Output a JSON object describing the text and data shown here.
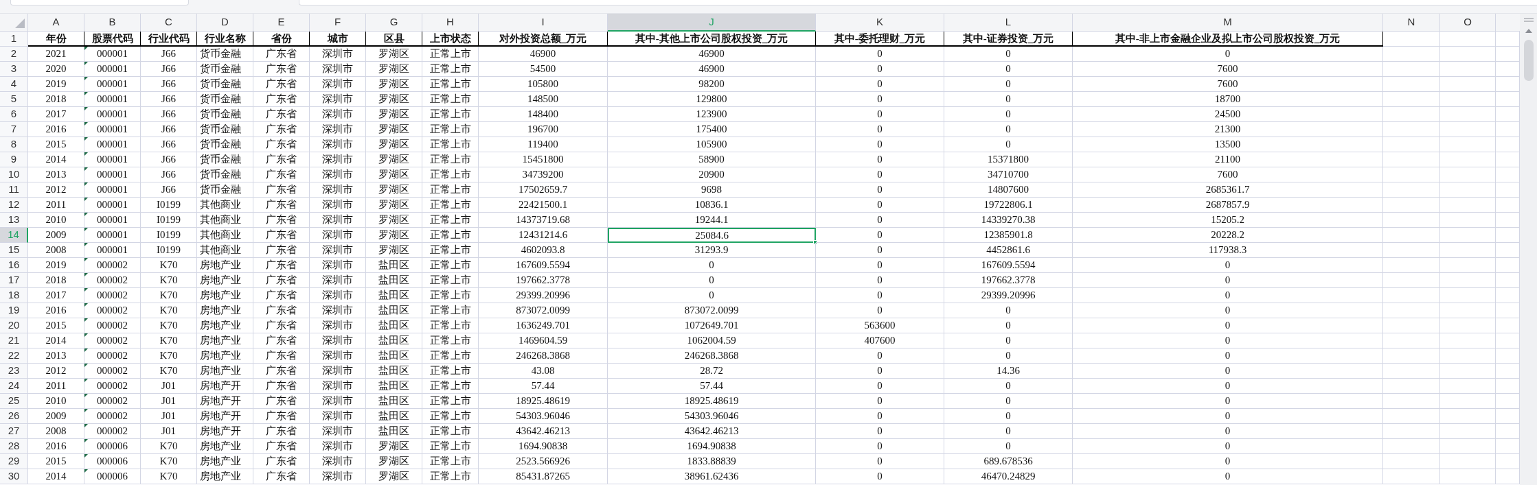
{
  "columns": [
    {
      "letter": "A",
      "selected": false
    },
    {
      "letter": "B",
      "selected": false
    },
    {
      "letter": "C",
      "selected": false
    },
    {
      "letter": "D",
      "selected": false
    },
    {
      "letter": "E",
      "selected": false
    },
    {
      "letter": "F",
      "selected": false
    },
    {
      "letter": "G",
      "selected": false
    },
    {
      "letter": "H",
      "selected": false
    },
    {
      "letter": "I",
      "selected": false
    },
    {
      "letter": "J",
      "selected": true
    },
    {
      "letter": "K",
      "selected": false
    },
    {
      "letter": "L",
      "selected": false
    },
    {
      "letter": "M",
      "selected": false
    },
    {
      "letter": "N",
      "selected": false
    },
    {
      "letter": "O",
      "selected": false
    }
  ],
  "header_row": {
    "number": "1",
    "selected": false,
    "cells": [
      "年份",
      "股票代码",
      "行业代码",
      "行业名称",
      "省份",
      "城市",
      "区县",
      "上市状态",
      "对外投资总额_万元",
      "其中-其他上市公司股权投资_万元",
      "其中-委托理财_万元",
      "其中-证券投资_万元",
      "其中-非上市金融企业及拟上市公司股权投资_万元"
    ]
  },
  "rows": [
    {
      "number": "2",
      "selected": false,
      "flagged": true,
      "cells": [
        "2021",
        "000001",
        "J66",
        "货币金融",
        "广东省",
        "深圳市",
        "罗湖区",
        "正常上市",
        "46900",
        "46900",
        "0",
        "0",
        "0"
      ]
    },
    {
      "number": "3",
      "selected": false,
      "flagged": true,
      "cells": [
        "2020",
        "000001",
        "J66",
        "货币金融",
        "广东省",
        "深圳市",
        "罗湖区",
        "正常上市",
        "54500",
        "46900",
        "0",
        "0",
        "7600"
      ]
    },
    {
      "number": "4",
      "selected": false,
      "flagged": true,
      "cells": [
        "2019",
        "000001",
        "J66",
        "货币金融",
        "广东省",
        "深圳市",
        "罗湖区",
        "正常上市",
        "105800",
        "98200",
        "0",
        "0",
        "7600"
      ]
    },
    {
      "number": "5",
      "selected": false,
      "flagged": true,
      "cells": [
        "2018",
        "000001",
        "J66",
        "货币金融",
        "广东省",
        "深圳市",
        "罗湖区",
        "正常上市",
        "148500",
        "129800",
        "0",
        "0",
        "18700"
      ]
    },
    {
      "number": "6",
      "selected": false,
      "flagged": true,
      "cells": [
        "2017",
        "000001",
        "J66",
        "货币金融",
        "广东省",
        "深圳市",
        "罗湖区",
        "正常上市",
        "148400",
        "123900",
        "0",
        "0",
        "24500"
      ]
    },
    {
      "number": "7",
      "selected": false,
      "flagged": true,
      "cells": [
        "2016",
        "000001",
        "J66",
        "货币金融",
        "广东省",
        "深圳市",
        "罗湖区",
        "正常上市",
        "196700",
        "175400",
        "0",
        "0",
        "21300"
      ]
    },
    {
      "number": "8",
      "selected": false,
      "flagged": true,
      "cells": [
        "2015",
        "000001",
        "J66",
        "货币金融",
        "广东省",
        "深圳市",
        "罗湖区",
        "正常上市",
        "119400",
        "105900",
        "0",
        "0",
        "13500"
      ]
    },
    {
      "number": "9",
      "selected": false,
      "flagged": true,
      "cells": [
        "2014",
        "000001",
        "J66",
        "货币金融",
        "广东省",
        "深圳市",
        "罗湖区",
        "正常上市",
        "15451800",
        "58900",
        "0",
        "15371800",
        "21100"
      ]
    },
    {
      "number": "10",
      "selected": false,
      "flagged": true,
      "cells": [
        "2013",
        "000001",
        "J66",
        "货币金融",
        "广东省",
        "深圳市",
        "罗湖区",
        "正常上市",
        "34739200",
        "20900",
        "0",
        "34710700",
        "7600"
      ]
    },
    {
      "number": "11",
      "selected": false,
      "flagged": true,
      "cells": [
        "2012",
        "000001",
        "J66",
        "货币金融",
        "广东省",
        "深圳市",
        "罗湖区",
        "正常上市",
        "17502659.7",
        "9698",
        "0",
        "14807600",
        "2685361.7"
      ]
    },
    {
      "number": "12",
      "selected": false,
      "flagged": true,
      "cells": [
        "2011",
        "000001",
        "I0199",
        "其他商业",
        "广东省",
        "深圳市",
        "罗湖区",
        "正常上市",
        "22421500.1",
        "10836.1",
        "0",
        "19722806.1",
        "2687857.9"
      ]
    },
    {
      "number": "13",
      "selected": false,
      "flagged": true,
      "cells": [
        "2010",
        "000001",
        "I0199",
        "其他商业",
        "广东省",
        "深圳市",
        "罗湖区",
        "正常上市",
        "14373719.68",
        "19244.1",
        "0",
        "14339270.38",
        "15205.2"
      ]
    },
    {
      "number": "14",
      "selected": true,
      "flagged": true,
      "cells": [
        "2009",
        "000001",
        "I0199",
        "其他商业",
        "广东省",
        "深圳市",
        "罗湖区",
        "正常上市",
        "12431214.6",
        "25084.6",
        "0",
        "12385901.8",
        "20228.2"
      ]
    },
    {
      "number": "15",
      "selected": false,
      "flagged": true,
      "cells": [
        "2008",
        "000001",
        "I0199",
        "其他商业",
        "广东省",
        "深圳市",
        "罗湖区",
        "正常上市",
        "4602093.8",
        "31293.9",
        "0",
        "4452861.6",
        "117938.3"
      ]
    },
    {
      "number": "16",
      "selected": false,
      "flagged": true,
      "cells": [
        "2019",
        "000002",
        "K70",
        "房地产业",
        "广东省",
        "深圳市",
        "盐田区",
        "正常上市",
        "167609.5594",
        "0",
        "0",
        "167609.5594",
        "0"
      ]
    },
    {
      "number": "17",
      "selected": false,
      "flagged": true,
      "cells": [
        "2018",
        "000002",
        "K70",
        "房地产业",
        "广东省",
        "深圳市",
        "盐田区",
        "正常上市",
        "197662.3778",
        "0",
        "0",
        "197662.3778",
        "0"
      ]
    },
    {
      "number": "18",
      "selected": false,
      "flagged": true,
      "cells": [
        "2017",
        "000002",
        "K70",
        "房地产业",
        "广东省",
        "深圳市",
        "盐田区",
        "正常上市",
        "29399.20996",
        "0",
        "0",
        "29399.20996",
        "0"
      ]
    },
    {
      "number": "19",
      "selected": false,
      "flagged": true,
      "cells": [
        "2016",
        "000002",
        "K70",
        "房地产业",
        "广东省",
        "深圳市",
        "盐田区",
        "正常上市",
        "873072.0099",
        "873072.0099",
        "0",
        "0",
        "0"
      ]
    },
    {
      "number": "20",
      "selected": false,
      "flagged": true,
      "cells": [
        "2015",
        "000002",
        "K70",
        "房地产业",
        "广东省",
        "深圳市",
        "盐田区",
        "正常上市",
        "1636249.701",
        "1072649.701",
        "563600",
        "0",
        "0"
      ]
    },
    {
      "number": "21",
      "selected": false,
      "flagged": true,
      "cells": [
        "2014",
        "000002",
        "K70",
        "房地产业",
        "广东省",
        "深圳市",
        "盐田区",
        "正常上市",
        "1469604.59",
        "1062004.59",
        "407600",
        "0",
        "0"
      ]
    },
    {
      "number": "22",
      "selected": false,
      "flagged": true,
      "cells": [
        "2013",
        "000002",
        "K70",
        "房地产业",
        "广东省",
        "深圳市",
        "盐田区",
        "正常上市",
        "246268.3868",
        "246268.3868",
        "0",
        "0",
        "0"
      ]
    },
    {
      "number": "23",
      "selected": false,
      "flagged": true,
      "cells": [
        "2012",
        "000002",
        "K70",
        "房地产业",
        "广东省",
        "深圳市",
        "盐田区",
        "正常上市",
        "43.08",
        "28.72",
        "0",
        "14.36",
        "0"
      ]
    },
    {
      "number": "24",
      "selected": false,
      "flagged": true,
      "cells": [
        "2011",
        "000002",
        "J01",
        "房地产开",
        "广东省",
        "深圳市",
        "盐田区",
        "正常上市",
        "57.44",
        "57.44",
        "0",
        "0",
        "0"
      ]
    },
    {
      "number": "25",
      "selected": false,
      "flagged": true,
      "cells": [
        "2010",
        "000002",
        "J01",
        "房地产开",
        "广东省",
        "深圳市",
        "盐田区",
        "正常上市",
        "18925.48619",
        "18925.48619",
        "0",
        "0",
        "0"
      ]
    },
    {
      "number": "26",
      "selected": false,
      "flagged": true,
      "cells": [
        "2009",
        "000002",
        "J01",
        "房地产开",
        "广东省",
        "深圳市",
        "盐田区",
        "正常上市",
        "54303.96046",
        "54303.96046",
        "0",
        "0",
        "0"
      ]
    },
    {
      "number": "27",
      "selected": false,
      "flagged": true,
      "cells": [
        "2008",
        "000002",
        "J01",
        "房地产开",
        "广东省",
        "深圳市",
        "盐田区",
        "正常上市",
        "43642.46213",
        "43642.46213",
        "0",
        "0",
        "0"
      ]
    },
    {
      "number": "28",
      "selected": false,
      "flagged": true,
      "cells": [
        "2016",
        "000006",
        "K70",
        "房地产业",
        "广东省",
        "深圳市",
        "罗湖区",
        "正常上市",
        "1694.90838",
        "1694.90838",
        "0",
        "0",
        "0"
      ]
    },
    {
      "number": "29",
      "selected": false,
      "flagged": true,
      "cells": [
        "2015",
        "000006",
        "K70",
        "房地产业",
        "广东省",
        "深圳市",
        "罗湖区",
        "正常上市",
        "2523.566926",
        "1833.88839",
        "0",
        "689.678536",
        "0"
      ]
    },
    {
      "number": "30",
      "selected": false,
      "flagged": true,
      "cells": [
        "2014",
        "000006",
        "K70",
        "房地产业",
        "广东省",
        "深圳市",
        "罗湖区",
        "正常上市",
        "85431.87265",
        "38961.62436",
        "0",
        "46470.24829",
        "0"
      ]
    }
  ]
}
